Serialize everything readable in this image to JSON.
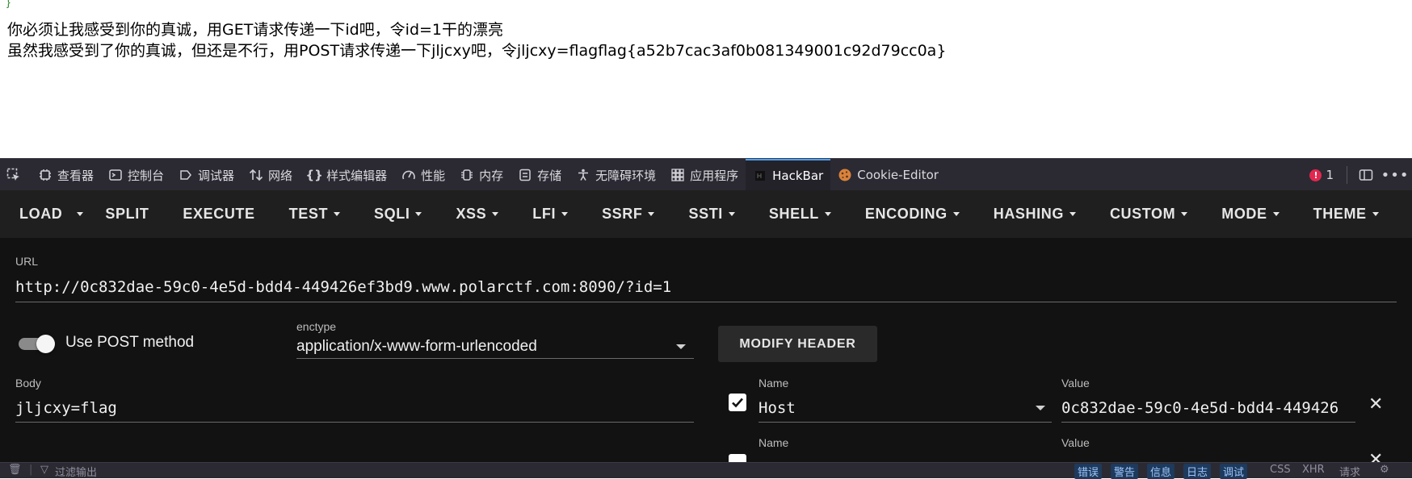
{
  "page": {
    "brace": "}",
    "line1": "你必须让我感受到你的真诚，用GET请求传递一下id吧，令id=1干的漂亮",
    "line2": "虽然我感受到了你的真诚，但还是不行，用POST请求传递一下jljcxy吧，令jljcxy=flagflag{a52b7cac3af0b081349001c92d79cc0a}"
  },
  "devtools": {
    "tabs": [
      {
        "label": "查看器",
        "icon": "inspector-icon"
      },
      {
        "label": "控制台",
        "icon": "console-icon"
      },
      {
        "label": "调试器",
        "icon": "debugger-icon"
      },
      {
        "label": "网络",
        "icon": "network-icon"
      },
      {
        "label": "样式编辑器",
        "icon": "style-editor-icon"
      },
      {
        "label": "性能",
        "icon": "performance-icon"
      },
      {
        "label": "内存",
        "icon": "memory-icon"
      },
      {
        "label": "存储",
        "icon": "storage-icon"
      },
      {
        "label": "无障碍环境",
        "icon": "accessibility-icon"
      },
      {
        "label": "应用程序",
        "icon": "application-icon"
      },
      {
        "label": "HackBar",
        "icon": "hackbar-icon"
      },
      {
        "label": "Cookie-Editor",
        "icon": "cookie-icon"
      }
    ],
    "error_count": "1"
  },
  "toolbar": {
    "load": "LOAD",
    "split": "SPLIT",
    "execute": "EXECUTE",
    "test": "TEST",
    "sqli": "SQLI",
    "xss": "XSS",
    "lfi": "LFI",
    "ssrf": "SSRF",
    "ssti": "SSTI",
    "shell": "SHELL",
    "encoding": "ENCODING",
    "hashing": "HASHING",
    "custom": "CUSTOM",
    "mode": "MODE",
    "theme": "THEME"
  },
  "form": {
    "url_label": "URL",
    "url_value": "http://0c832dae-59c0-4e5d-bdd4-449426ef3bd9.www.polarctf.com:8090/?id=1",
    "post_toggle_label": "Use POST method",
    "post_enabled": true,
    "enctype_label": "enctype",
    "enctype_value": "application/x-www-form-urlencoded",
    "modify_header": "MODIFY HEADER",
    "body_label": "Body",
    "body_value": "jljcxy=flag",
    "headers": [
      {
        "name_label": "Name",
        "name": "Host",
        "value_label": "Value",
        "value": "0c832dae-59c0-4e5d-bdd4-449426",
        "enabled": true
      },
      {
        "name_label": "Name",
        "name": "",
        "value_label": "Value",
        "value": "",
        "enabled": true
      }
    ]
  },
  "console": {
    "filter_placeholder": "过滤输出",
    "filters": [
      "错误",
      "警告",
      "信息",
      "日志",
      "调试"
    ],
    "extras": [
      "CSS",
      "XHR",
      "请求"
    ]
  },
  "colors": {
    "hackbar_bg": "#121212",
    "toolbar_bg": "#1f1f1f",
    "devtools_bg": "#2b2a33",
    "active_tab_accent": "#4a9fff",
    "error_badge": "#e22850"
  }
}
